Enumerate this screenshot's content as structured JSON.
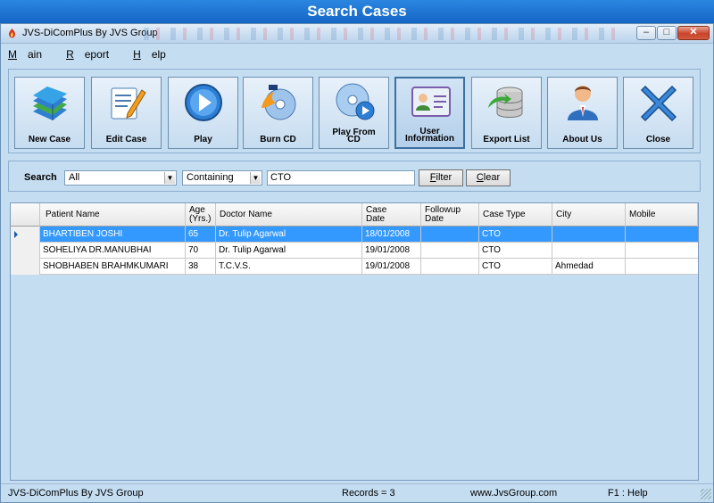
{
  "banner": {
    "title": "Search Cases"
  },
  "window": {
    "title": "JVS-DiComPlus By JVS Group",
    "controls": {
      "minimize": "–",
      "maximize": "□",
      "close": "✕"
    }
  },
  "menu": [
    {
      "label_u": "M",
      "label_rest": "ain"
    },
    {
      "label_u": "R",
      "label_rest": "eport"
    },
    {
      "label_u": "H",
      "label_rest": "elp"
    }
  ],
  "toolbar": {
    "new_case": "New Case",
    "edit_case": "Edit Case",
    "play": "Play",
    "burn_cd": "Burn CD",
    "play_from_cd_1": "Play From",
    "play_from_cd_2": "CD",
    "user_information_1": "User",
    "user_information_2": "Information",
    "export_list": "Export List",
    "about_us": "About Us",
    "close": "Close"
  },
  "search": {
    "label": "Search",
    "field_value": "All",
    "mode_value": "Containing",
    "text_value": "CTO",
    "filter_u": "F",
    "filter_rest": "ilter",
    "clear_u": "C",
    "clear_rest": "lear"
  },
  "table": {
    "headers": {
      "patient_name": "Patient Name",
      "age_1": "Age",
      "age_2": "(Yrs.)",
      "doctor_name": "Doctor Name",
      "case_date_1": "Case",
      "case_date_2": "Date",
      "followup_date_1": "Followup",
      "followup_date_2": "Date",
      "case_type": "Case Type",
      "city": "City",
      "mobile": "Mobile"
    },
    "rows": [
      {
        "patient_name": "BHARTIBEN JOSHI",
        "age": "65",
        "doctor_name": "Dr. Tulip Agarwal",
        "case_date": "18/01/2008",
        "followup_date": "",
        "case_type": "CTO",
        "city": "",
        "mobile": ""
      },
      {
        "patient_name": "SOHELIYA DR.MANUBHAI",
        "age": "70",
        "doctor_name": "Dr. Tulip Agarwal",
        "case_date": "19/01/2008",
        "followup_date": "",
        "case_type": "CTO",
        "city": "",
        "mobile": ""
      },
      {
        "patient_name": "SHOBHABEN BRAHMKUMARI",
        "age": "38",
        "doctor_name": "T.C.V.S.",
        "case_date": "19/01/2008",
        "followup_date": "",
        "case_type": "CTO",
        "city": "Ahmedad",
        "mobile": ""
      }
    ]
  },
  "status": {
    "app": "JVS-DiComPlus By JVS Group",
    "records": "Records = 3",
    "website": "www.JvsGroup.com",
    "help": "F1 : Help"
  },
  "colors": {
    "accent": "#3399ff",
    "panel": "#c4ddf1",
    "banner": "#1a6bc4"
  }
}
